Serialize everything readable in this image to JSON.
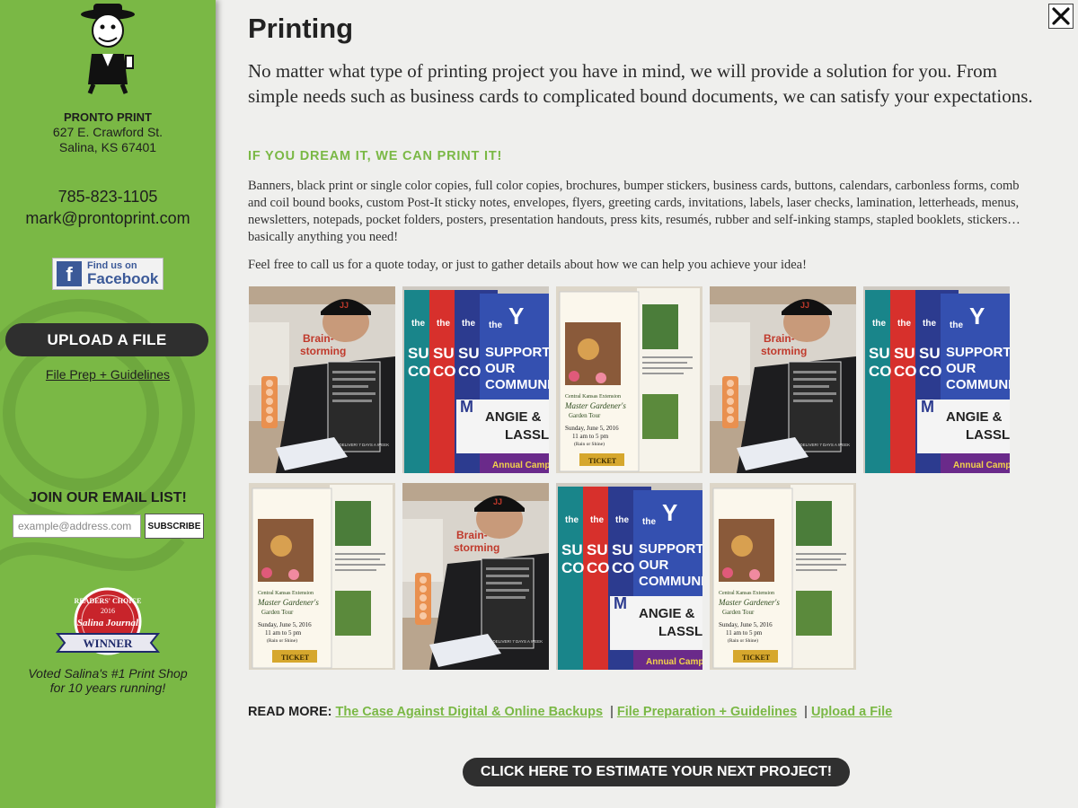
{
  "sidebar": {
    "business_name": "PRONTO PRINT",
    "address_line1": "627 E. Crawford St.",
    "address_line2": "Salina, KS 67401",
    "phone": "785-823-1105",
    "email": "mark@prontoprint.com",
    "facebook_small": "Find us on",
    "facebook_big": "Facebook",
    "upload_label": "UPLOAD A FILE",
    "file_prep_label": "File Prep + Guidelines",
    "email_list_title": "JOIN OUR EMAIL LIST!",
    "email_placeholder": "example@address.com",
    "subscribe_label": "SUBSCRIBE",
    "award": {
      "readers_choice": "READERS' CHOICE",
      "year": "2016",
      "paper": "Salina Journal",
      "winner": "WINNER"
    },
    "voted_line1": "Voted Salina's #1 Print Shop",
    "voted_line2": "for 10 years running!"
  },
  "main": {
    "title": "Printing",
    "intro": "No matter what type of printing project you have in mind, we will provide a solution for you. From simple needs such as business cards to complicated bound documents, we can satisfy your expectations.",
    "tagline": "IF YOU DREAM IT, WE CAN PRINT IT!",
    "services": "Banners, black print or single color copies, full color copies, brochures, bumper stickers, business cards, buttons, calendars, carbonless forms, comb and coil bound books, custom Post-It sticky notes, envelopes, flyers, greeting cards, invitations, labels, laser checks, lamination, letterheads, menus, newsletters, notepads, pocket folders, posters, presentation handouts, press kits, resumés, rubber and self-inking stamps, stapled booklets, stickers… basically anything you need!",
    "call_note": "Feel free to call us for a quote today, or just to gather details about how we can help you achieve your idea!",
    "gallery": [
      {
        "kind": "person"
      },
      {
        "kind": "banners"
      },
      {
        "kind": "garden"
      },
      {
        "kind": "person"
      },
      {
        "kind": "banners"
      },
      {
        "kind": "garden"
      },
      {
        "kind": "person"
      },
      {
        "kind": "banners"
      },
      {
        "kind": "garden"
      }
    ],
    "photo_text": {
      "banner_the": "the",
      "banner_y": "Y",
      "banner_support": "SUPPORT",
      "banner_our": "OUR",
      "banner_community": "COMMUNITY",
      "banner_name1": "ANGIE &",
      "banner_name2": "LASSLI",
      "banner_campaign": "Annual Camp",
      "banner_su": "SU",
      "banner_co": "CO",
      "banner_m": "M",
      "garden_org": "Central Kansas Extension",
      "garden_title1": "Master Gardener's",
      "garden_title2": "Garden Tour",
      "garden_date": "Sunday, June 5, 2016",
      "garden_time": "11 am to 5 pm",
      "garden_rain": "(Rain or Shine)",
      "garden_ticket": "TICKET",
      "person_sign1": "Brain-",
      "person_sign2": "storming",
      "person_cap": "JJ",
      "person_flyer": "WE DELIVER! 7 DAYS A WEEK"
    },
    "read_more_label": "READ MORE:",
    "read_more_links": [
      "The Case Against Digital & Online Backups",
      "File Preparation + Guidelines",
      "Upload a File"
    ],
    "read_more_separator": "|",
    "estimate_label": "CLICK HERE TO ESTIMATE YOUR NEXT PROJECT!",
    "close_glyph": "✕"
  },
  "colors": {
    "sidebar_green": "#7ab845",
    "accent_green": "#7ab845",
    "dark_button": "#2f2f2f",
    "facebook_blue": "#3b5998"
  }
}
